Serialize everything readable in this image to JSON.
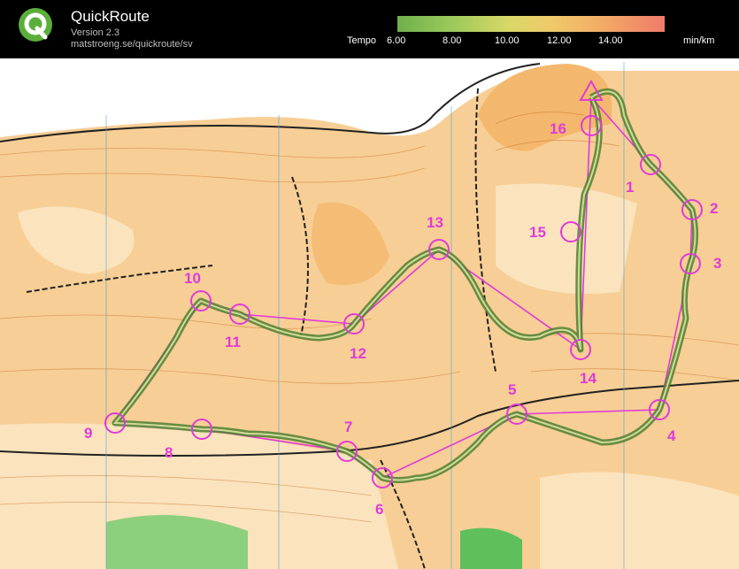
{
  "app": {
    "name": "QuickRoute",
    "version": "Version 2.3",
    "url": "matstroeng.se/quickroute/sv"
  },
  "legend": {
    "label": "Tempo",
    "ticks": [
      "6.00",
      "8.00",
      "10.00",
      "12.00",
      "14.00"
    ],
    "unit": "min/km"
  },
  "map": {
    "controls": [
      "1",
      "2",
      "3",
      "4",
      "5",
      "6",
      "7",
      "8",
      "9",
      "10",
      "11",
      "12",
      "13",
      "14",
      "15",
      "16"
    ],
    "course_color": "#e03ad8",
    "route_color": "#5f8f3e",
    "terrain_color": "#f6c98a"
  }
}
